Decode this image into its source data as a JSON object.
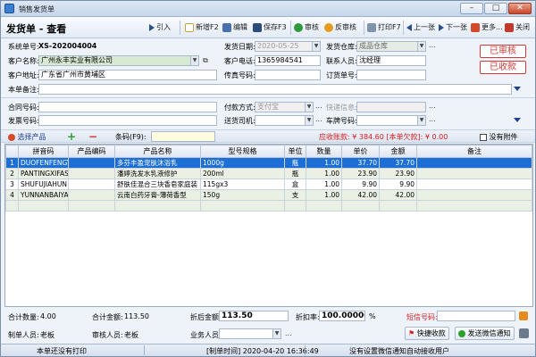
{
  "window": {
    "title": "销售发货单"
  },
  "toolbar": {
    "doc_title": "发货单 - 查看",
    "import": "引入",
    "new": "新增F2",
    "edit": "编辑",
    "save": "保存F3",
    "audit": "审核",
    "unaudit": "反审核",
    "print": "打印F7",
    "prev": "上一张",
    "next": "下一张",
    "more": "更多...",
    "close": "关闭"
  },
  "form": {
    "system_no_label": "系统单号:",
    "system_no": "XS-202004004",
    "customer_label": "客户名称:",
    "customer": "广州永丰实业有限公司",
    "address_label": "客户地址:",
    "address": "广东省广州市黄埔区",
    "remark_label": "本单备注:",
    "remark": "",
    "ship_date_label": "发货日期:",
    "ship_date": "2020-05-25",
    "phone_label": "客户电话:",
    "phone": "1365984541",
    "fax_label": "传真号码:",
    "fax": "",
    "warehouse_label": "发货仓库:",
    "warehouse": "成品仓库",
    "contact_label": "联系人员:",
    "contact": "沈经理",
    "order_no_label": "订货单号:",
    "order_no": "",
    "contract_label": "合同号码:",
    "contract": "",
    "invoice_label": "发票号码:",
    "invoice": "",
    "payment_label": "付款方式:",
    "payment": "支付宝",
    "driver_label": "送货司机:",
    "driver": "",
    "express_label": "快递信息:",
    "express": "",
    "plate_label": "车牌号码:",
    "plate": "",
    "stamp_audited": "已审核",
    "stamp_received": "已收款",
    "dots": "..."
  },
  "product_bar": {
    "select": "选择产品",
    "barcode_label": "条码(F9):",
    "barcode": "",
    "receivable": "应收账款: ¥ 384.60 [本单欠款]: ¥ 0.00",
    "attachment": "没有附件"
  },
  "table": {
    "headers": [
      "",
      "拼音码",
      "产品编码",
      "产品名称",
      "型号规格",
      "单位",
      "数量",
      "单价",
      "金额",
      "备注"
    ],
    "rows": [
      {
        "idx": "1",
        "pinyin": "DUOFENFENGY",
        "code": "",
        "name": "多芬丰盈宠肤沐浴乳",
        "spec": "1000g",
        "unit": "瓶",
        "qty": "1.00",
        "price": "37.70",
        "amount": "37.70",
        "note": ""
      },
      {
        "idx": "2",
        "pinyin": "PANTINGXIFAS",
        "code": "",
        "name": "潘婷洗发水乳液修护",
        "spec": "200ml",
        "unit": "瓶",
        "qty": "1.00",
        "price": "23.90",
        "amount": "23.90",
        "note": ""
      },
      {
        "idx": "3",
        "pinyin": "SHUFUJIAHUN",
        "code": "",
        "name": "舒肤佳混合三块香皂家庭装",
        "spec": "115gx3",
        "unit": "盒",
        "qty": "1.00",
        "price": "9.90",
        "amount": "9.90",
        "note": ""
      },
      {
        "idx": "4",
        "pinyin": "YUNNANBAIYA",
        "code": "",
        "name": "云南白药牙膏-薄荷香型",
        "spec": "150g",
        "unit": "支",
        "qty": "1.00",
        "price": "42.00",
        "amount": "42.00",
        "note": ""
      }
    ]
  },
  "summary": {
    "total_qty_label": "合计数量:",
    "total_qty": "4.00",
    "total_amount_label": "合计金额:",
    "total_amount": "113.50",
    "discounted_label": "折后金额:",
    "discounted": "113.50",
    "discount_rate_label": "折扣率:",
    "discount_rate": "100.000000",
    "percent": "%",
    "sms_label": "短信号码:",
    "sms": "",
    "maker_label": "制单人员:",
    "maker": "老板",
    "auditor_label": "审核人员:",
    "auditor": "老板",
    "salesman_label": "业务人员:",
    "salesman": "",
    "quick_pay": "快捷收款",
    "wechat_notice": "发送微信通知"
  },
  "status": {
    "print_status": "本单还没有打印",
    "made_time": "[制单时间] 2020-04-20 16:36:49",
    "wechat_status": "没有设置微信通知自动接收用户"
  },
  "colors": {
    "selected_row": "#1d6fd6",
    "stamp_red": "#d23a3a",
    "alt_row": "#eaf1e4",
    "receivable_red": "#d41d1d",
    "sms_label_red": "#d41d1d"
  }
}
